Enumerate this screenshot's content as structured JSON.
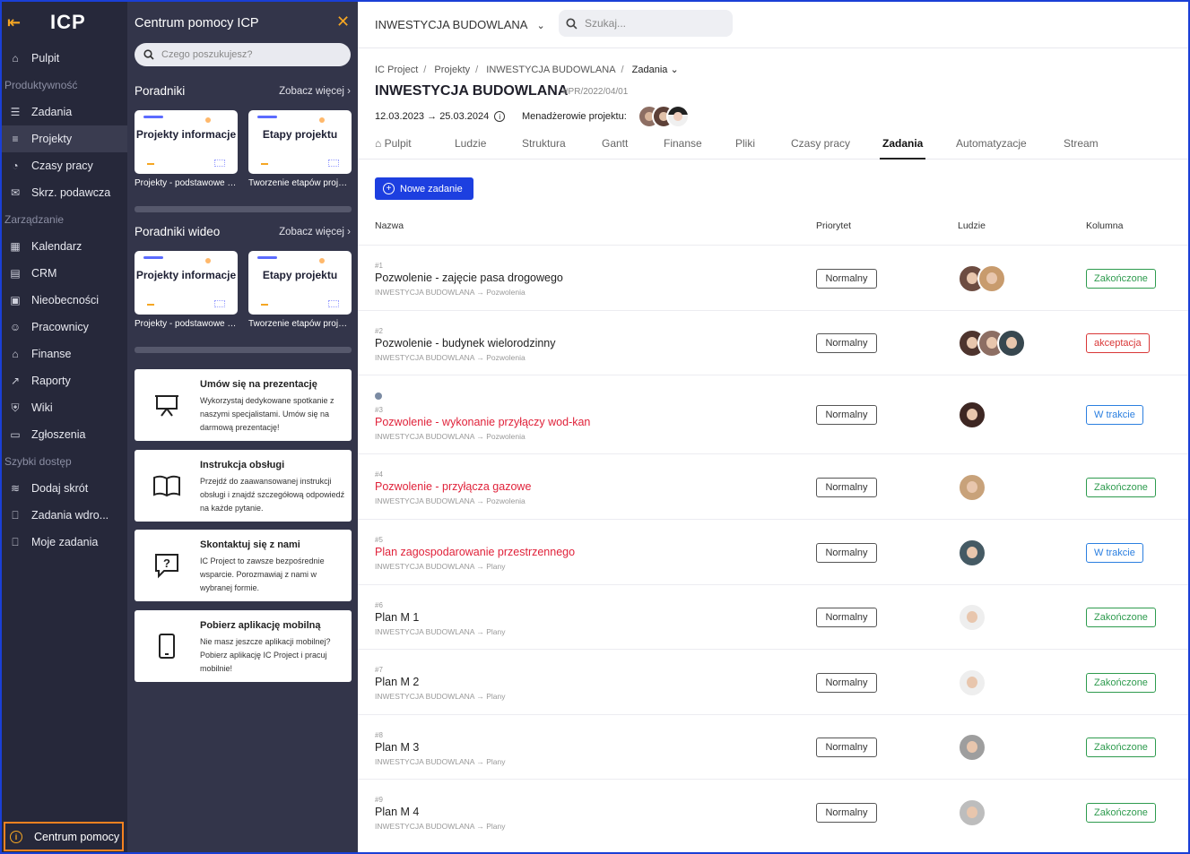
{
  "app": {
    "logo": "ICP"
  },
  "nav": {
    "items": [
      {
        "type": "item",
        "label": "Pulpit",
        "icon": "home-icon"
      },
      {
        "type": "section",
        "label": "Produktywność"
      },
      {
        "type": "item",
        "label": "Zadania",
        "icon": "tasks-icon"
      },
      {
        "type": "item",
        "label": "Projekty",
        "icon": "projects-icon",
        "active": true
      },
      {
        "type": "item",
        "label": "Czasy pracy",
        "icon": "time-icon"
      },
      {
        "type": "item",
        "label": "Skrz. podawcza",
        "icon": "inbox-icon"
      },
      {
        "type": "section",
        "label": "Zarządzanie"
      },
      {
        "type": "item",
        "label": "Kalendarz",
        "icon": "calendar-icon"
      },
      {
        "type": "item",
        "label": "CRM",
        "icon": "crm-icon"
      },
      {
        "type": "item",
        "label": "Nieobecności",
        "icon": "absence-icon"
      },
      {
        "type": "item",
        "label": "Pracownicy",
        "icon": "employees-icon"
      },
      {
        "type": "item",
        "label": "Finanse",
        "icon": "finance-icon"
      },
      {
        "type": "item",
        "label": "Raporty",
        "icon": "reports-icon"
      },
      {
        "type": "item",
        "label": "Wiki",
        "icon": "wiki-icon"
      },
      {
        "type": "item",
        "label": "Zgłoszenia",
        "icon": "tickets-icon"
      },
      {
        "type": "section",
        "label": "Szybki dostęp"
      },
      {
        "type": "item",
        "label": "Dodaj skrót",
        "icon": "layers-icon"
      },
      {
        "type": "item",
        "label": "Zadania wdro...",
        "icon": "bookmark-icon"
      },
      {
        "type": "item",
        "label": "Moje zadania",
        "icon": "bookmark-icon"
      }
    ],
    "help_label": "Centrum pomocy"
  },
  "help": {
    "title": "Centrum pomocy ICP",
    "search_placeholder": "Czego poszukujesz?",
    "guides": {
      "title": "Poradniki",
      "more": "Zobacz więcej"
    },
    "videos": {
      "title": "Poradniki wideo",
      "more": "Zobacz więcej"
    },
    "cards": [
      {
        "thumb": "Projekty informacje",
        "caption": "Projekty - podstawowe informacje"
      },
      {
        "thumb": "Etapy projektu",
        "caption": "Tworzenie etapów projektu"
      }
    ],
    "info": [
      {
        "title": "Umów się na prezentację",
        "desc": "Wykorzystaj dedykowane spotkanie z naszymi specjalistami. Umów się na darmową prezentację!",
        "icon": "presentation-icon"
      },
      {
        "title": "Instrukcja obsługi",
        "desc": "Przejdź do zaawansowanej instrukcji obsługi i znajdź szczegółową odpowiedź na każde pytanie.",
        "icon": "book-icon"
      },
      {
        "title": "Skontaktuj się z nami",
        "desc": "IC Project to zawsze bezpośrednie wsparcie. Porozmawiaj z nami w wybranej formie.",
        "icon": "question-chat-icon"
      },
      {
        "title": "Pobierz aplikację mobilną",
        "desc": "Nie masz jeszcze aplikacji mobilnej? Pobierz aplikację IC Project i pracuj mobilnie!",
        "icon": "phone-icon"
      }
    ]
  },
  "topbar": {
    "project": "INWESTYCJA BUDOWLANA",
    "search_placeholder": "Szukaj..."
  },
  "breadcrumb": [
    "IC Project",
    "Projekty",
    "INWESTYCJA BUDOWLANA",
    "Zadania"
  ],
  "project": {
    "title": "INWESTYCJA BUDOWLANA",
    "code": "#PR/2022/04/01",
    "start": "12.03.2023",
    "end": "25.03.2024",
    "managers_label": "Menadżerowie projektu:"
  },
  "tabs": [
    "Pulpit",
    "Ludzie",
    "Struktura",
    "Gantt",
    "Finanse",
    "Pliki",
    "Czasy pracy",
    "Zadania",
    "Automatyzacje",
    "Stream"
  ],
  "active_tab": "Zadania",
  "new_task": "Nowe zadanie",
  "table": {
    "headers": [
      "Nazwa",
      "Priorytet",
      "Ludzie",
      "Kolumna"
    ],
    "rows": [
      {
        "num": "#1",
        "name": "Pozwolenie - zajęcie pasa drogowego",
        "path": "INWESTYCJA BUDOWLANA → Pozwolenia",
        "priority": "Normalny",
        "status": "Zakończone",
        "status_type": "done",
        "red": false,
        "people": 2
      },
      {
        "num": "#2",
        "name": "Pozwolenie - budynek wielorodzinny",
        "path": "INWESTYCJA BUDOWLANA → Pozwolenia",
        "priority": "Normalny",
        "status": "akceptacja",
        "status_type": "acc",
        "red": false,
        "people": 3
      },
      {
        "num": "#3",
        "name": "Pozwolenie - wykonanie przyłączy wod-kan",
        "path": "INWESTYCJA BUDOWLANA → Pozwolenia",
        "priority": "Normalny",
        "status": "W trakcie",
        "status_type": "prog",
        "red": true,
        "people": 1
      },
      {
        "num": "#4",
        "name": "Pozwolenie - przyłącza gazowe",
        "path": "INWESTYCJA BUDOWLANA → Pozwolenia",
        "priority": "Normalny",
        "status": "Zakończone",
        "status_type": "done",
        "red": true,
        "people": 1
      },
      {
        "num": "#5",
        "name": "Plan zagospodarowanie przestrzennego",
        "path": "INWESTYCJA BUDOWLANA → Plany",
        "priority": "Normalny",
        "status": "W trakcie",
        "status_type": "prog",
        "red": true,
        "people": 1
      },
      {
        "num": "#6",
        "name": "Plan M 1",
        "path": "INWESTYCJA BUDOWLANA → Plany",
        "priority": "Normalny",
        "status": "Zakończone",
        "status_type": "done",
        "red": false,
        "people": 1
      },
      {
        "num": "#7",
        "name": "Plan M 2",
        "path": "INWESTYCJA BUDOWLANA → Plany",
        "priority": "Normalny",
        "status": "Zakończone",
        "status_type": "done",
        "red": false,
        "people": 1
      },
      {
        "num": "#8",
        "name": "Plan M 3",
        "path": "INWESTYCJA BUDOWLANA → Plany",
        "priority": "Normalny",
        "status": "Zakończone",
        "status_type": "done",
        "red": false,
        "people": 1
      },
      {
        "num": "#9",
        "name": "Plan M 4",
        "path": "INWESTYCJA BUDOWLANA → Plany",
        "priority": "Normalny",
        "status": "Zakończone",
        "status_type": "done",
        "red": false,
        "people": 1
      }
    ]
  },
  "colors": {
    "accent": "#1d3fe0",
    "highlight": "#f58220",
    "nav_bg": "#26283a",
    "panel_bg": "#33354a",
    "danger": "#e0223a"
  }
}
